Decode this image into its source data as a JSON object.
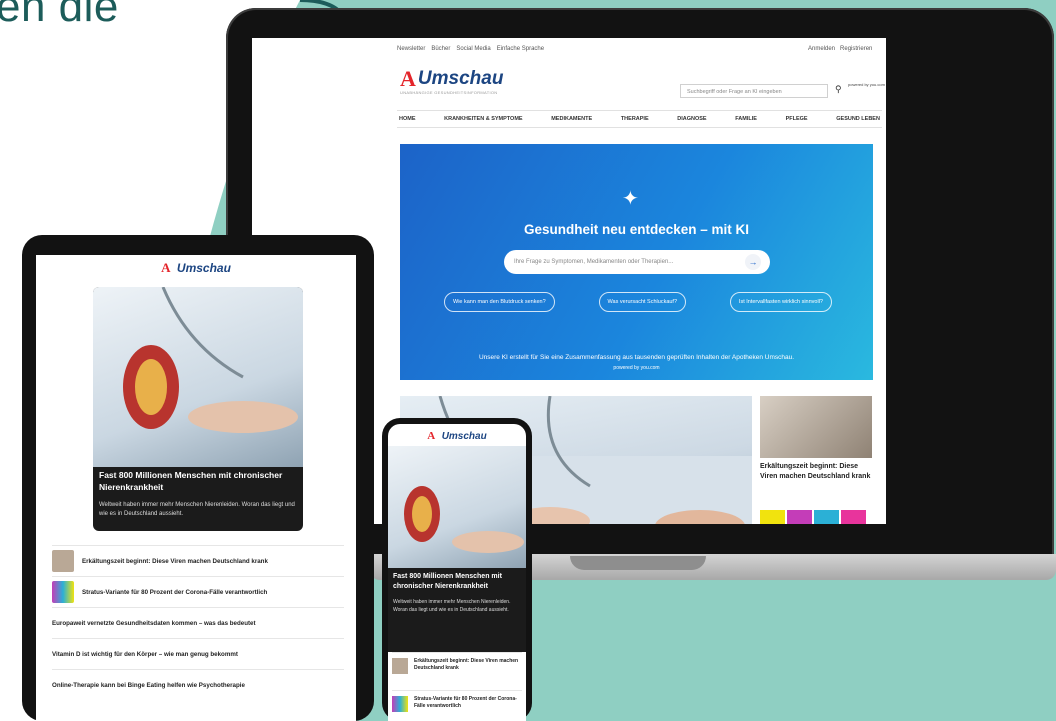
{
  "background": {
    "heading_fragment": "en die",
    "shape_color": "#8fcfc2",
    "heading_color": "#1c5c5a"
  },
  "brand": {
    "logo_mark": "A",
    "logo_word": "Umschau",
    "red": "#e4252b",
    "blue": "#1c4582"
  },
  "desktop": {
    "top_links": [
      "Newsletter",
      "Bücher",
      "Social Media",
      "Einfache Sprache"
    ],
    "auth_links": [
      "Anmelden",
      "Registrieren"
    ],
    "tagline": "UNABHÄNGIGE GESUNDHEITSINFORMATION",
    "search_placeholder": "Suchbegriff oder Frage an KI eingeben",
    "powered_label": "powered by you.com",
    "nav": [
      "HOME",
      "KRANKHEITEN & SYMPTOME",
      "MEDIKAMENTE",
      "THERAPIE",
      "DIAGNOSE",
      "FAMILIE",
      "PFLEGE",
      "GESUND LEBEN"
    ],
    "hero": {
      "title": "Gesundheit neu entdecken – mit KI",
      "input_placeholder": "Ihre Frage zu Symptomen, Medikamenten oder Therapien...",
      "chips": [
        "Wie kann man den Blutdruck senken?",
        "Was verursacht Schluckauf?",
        "Ist Intervallfasten wirklich sinnvoll?"
      ],
      "note": "Unsere KI erstellt für Sie eine Zusammenfassung aus tausenden geprüften Inhalten der Apotheken Umschau.",
      "powered": "powered by you.com"
    },
    "side_article_title": "Erkältungszeit beginnt: Diese Viren machen Deutschland krank"
  },
  "tablet": {
    "feature_title": "Fast 800 Millionen Menschen mit chronischer Nierenkrankheit",
    "feature_sub": "Weltweit haben immer mehr Menschen Nierenleiden. Woran das liegt und wie es in Deutschland aussieht.",
    "list": [
      {
        "title": "Erkältungszeit beginnt: Diese Viren machen Deutschland krank"
      },
      {
        "title": "Stratus-Variante für 80 Prozent der Corona-Fälle verantwortlich"
      },
      {
        "title": "Europaweit vernetzte Gesundheitsdaten kommen – was das bedeutet"
      },
      {
        "title": "Vitamin D ist wichtig für den Körper – wie man genug bekommt"
      },
      {
        "title": "Online-Therapie kann bei Binge Eating helfen wie Psychotherapie"
      }
    ]
  },
  "phone": {
    "feature_title": "Fast 800 Millionen Menschen mit chronischer Nierenkrankheit",
    "feature_sub": "Weltweit haben immer mehr Menschen Nierenleiden. Woran das liegt und wie es in Deutschland aussieht.",
    "list": [
      {
        "title": "Erkältungszeit beginnt: Diese Viren machen Deutschland krank"
      },
      {
        "title": "Stratus-Variante für 80 Prozent der Corona-Fälle verantwortlich"
      }
    ]
  }
}
